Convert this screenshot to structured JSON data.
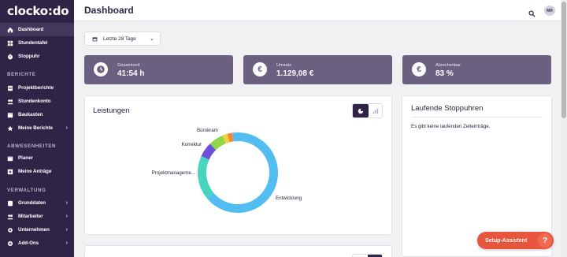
{
  "app": {
    "logo": "clocko:do"
  },
  "sidebar": {
    "items_top": [
      {
        "label": "Dashboard",
        "icon": "home-icon",
        "active": true
      },
      {
        "label": "Stundentafel",
        "icon": "grid-icon"
      },
      {
        "label": "Stoppuhr",
        "icon": "stopwatch-icon"
      }
    ],
    "sections": [
      {
        "title": "BERICHTE",
        "items": [
          {
            "label": "Projektberichte",
            "icon": "report-icon"
          },
          {
            "label": "Stundenkonto",
            "icon": "people-icon"
          },
          {
            "label": "Baukasten",
            "icon": "box-icon"
          },
          {
            "label": "Meine Berichte",
            "icon": "star-icon",
            "chevron": true
          }
        ]
      },
      {
        "title": "ABWESENHEITEN",
        "items": [
          {
            "label": "Planer",
            "icon": "calendar-icon"
          },
          {
            "label": "Meine Anträge",
            "icon": "plus-square-icon"
          }
        ]
      },
      {
        "title": "VERWALTUNG",
        "items": [
          {
            "label": "Grunddaten",
            "icon": "database-icon",
            "chevron": true
          },
          {
            "label": "Mitarbeiter",
            "icon": "team-icon",
            "chevron": true
          },
          {
            "label": "Unternehmen",
            "icon": "gear-icon",
            "chevron": true
          },
          {
            "label": "Add-Ons",
            "icon": "addon-icon",
            "chevron": true
          }
        ]
      }
    ]
  },
  "header": {
    "title": "Dashboard",
    "avatar": "MR"
  },
  "filter": {
    "date_range": "Letzte 28 Tage"
  },
  "stats": [
    {
      "label": "Gesamtzeit",
      "value": "41:54 h",
      "icon": "clock-icon"
    },
    {
      "label": "Umsatz",
      "value": "1.129,08 €",
      "icon": "euro-icon"
    },
    {
      "label": "Abrechenbar",
      "value": "83 %",
      "icon": "euro-icon"
    }
  ],
  "leistungen": {
    "title": "Leistungen"
  },
  "stopwatches": {
    "title": "Laufende Stoppuhren",
    "empty": "Es gibt keine laufenden Zeiteinträge."
  },
  "setup": {
    "label": "Setup-Assistent"
  },
  "colors": {
    "sidebar": "#2f2446",
    "stat": "#6b6080",
    "accent": "#e8553d"
  },
  "chart_data": {
    "type": "pie",
    "title": "Leistungen",
    "donut": true,
    "slices": [
      {
        "label": "Entwicklung",
        "value": 66,
        "color": "#52bdf0"
      },
      {
        "label": "Projektmanageme...",
        "value": 18,
        "color": "#48d4bf"
      },
      {
        "label": "Korrektur",
        "value": 6,
        "color": "#6d4fdc"
      },
      {
        "label": "Bürokram",
        "value": 6,
        "color": "#8fd64b"
      },
      {
        "label": "",
        "value": 2,
        "color": "#f3cf3b"
      },
      {
        "label": "",
        "value": 2,
        "color": "#f48a37"
      }
    ]
  }
}
